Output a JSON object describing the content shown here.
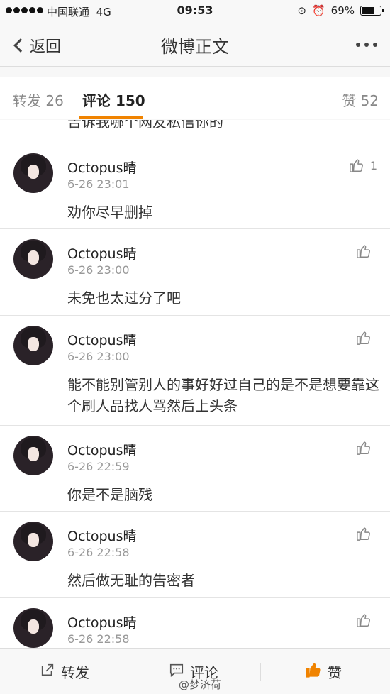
{
  "status_bar": {
    "carrier": "中国联通",
    "network": "4G",
    "time": "09:53",
    "battery": "69%",
    "battery_level": 0.69
  },
  "nav": {
    "back_label": "返回",
    "title": "微博正文"
  },
  "tabs": {
    "repost": "转发 26",
    "comment": "评论 150",
    "like": "赞 52"
  },
  "cut_comment": "告诉我哪个网友私信你的",
  "comments": [
    {
      "username": "Octopus晴",
      "time": "6-26 23:01",
      "text": "劝你尽早删掉",
      "likes": "1"
    },
    {
      "username": "Octopus晴",
      "time": "6-26 23:00",
      "text": "未免也太过分了吧",
      "likes": ""
    },
    {
      "username": "Octopus晴",
      "time": "6-26 23:00",
      "text": "能不能别管别人的事好好过自己的是不是想要靠这个刷人品找人骂然后上头条",
      "likes": ""
    },
    {
      "username": "Octopus晴",
      "time": "6-26 22:59",
      "text": "你是不是脑残",
      "likes": ""
    },
    {
      "username": "Octopus晴",
      "time": "6-26 22:58",
      "text": "然后做无耻的告密者",
      "likes": ""
    },
    {
      "username": "Octopus晴",
      "time": "6-26 22:58",
      "text": "",
      "likes": ""
    }
  ],
  "bottom": {
    "repost": "转发",
    "comment": "评论",
    "like": "赞",
    "watermark": "@梦济荷"
  },
  "colors": {
    "accent": "#f08300"
  }
}
